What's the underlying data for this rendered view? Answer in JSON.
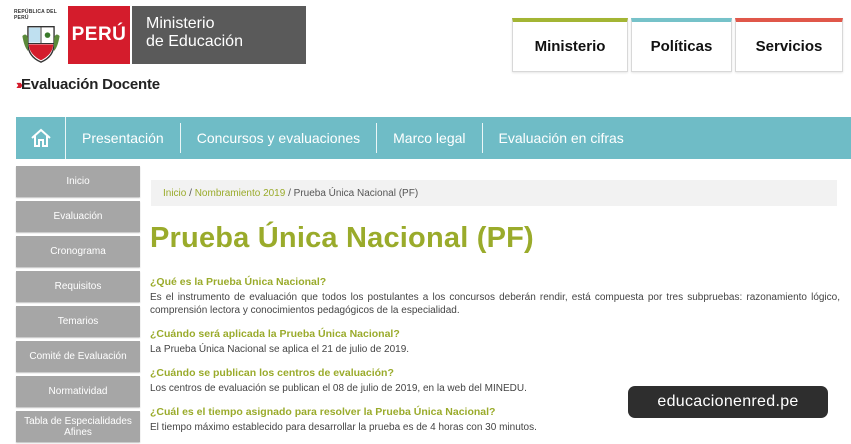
{
  "header": {
    "shield_text": "REPÚBLICA DEL PERÚ",
    "country": "PERÚ",
    "ministry_line1": "Ministerio",
    "ministry_line2": "de Educación",
    "section_chevrons": "›››",
    "section_title": "Evaluación Docente"
  },
  "top_tabs": [
    {
      "label": "Ministerio",
      "color": "#a3b534"
    },
    {
      "label": "Políticas",
      "color": "#76c2c9"
    },
    {
      "label": "Servicios",
      "color": "#e0574a"
    }
  ],
  "nav": {
    "home_icon": "home-icon",
    "items": [
      "Presentación",
      "Concursos y evaluaciones",
      "Marco legal",
      "Evaluación en cifras"
    ]
  },
  "sidebar": {
    "items": [
      "Inicio",
      "Evaluación",
      "Cronograma",
      "Requisitos",
      "Temarios",
      "Comité de Evaluación",
      "Normatividad",
      "Tabla de Especialidades Afines"
    ]
  },
  "breadcrumb": {
    "home": "Inicio",
    "sep1": " / ",
    "parent": "Nombramiento 2019",
    "sep2": " / ",
    "current": "Prueba Única Nacional (PF)"
  },
  "page_title": "Prueba Única Nacional (PF)",
  "faq": [
    {
      "question": "¿Qué es la Prueba Única Nacional?",
      "answer": "Es el instrumento de evaluación que todos los postulantes a los concursos deberán rendir, está compuesta por tres subpruebas: razonamiento lógico, comprensión lectora y conocimientos pedagógicos de la especialidad."
    },
    {
      "question": "¿Cuándo será aplicada la Prueba Única Nacional?",
      "answer": "La Prueba Única Nacional se aplica el 21 de julio de 2019."
    },
    {
      "question": "¿Cuándo se publican los centros de evaluación?",
      "answer": "Los centros de evaluación se publican el 08 de julio de 2019, en la web del MINEDU."
    },
    {
      "question": "¿Cuál es el tiempo asignado para resolver la Prueba Única Nacional?",
      "answer": "El tiempo máximo establecido para desarrollar la prueba es de 4 horas con 30 minutos."
    }
  ],
  "watermark": "educacionenred.pe",
  "colors": {
    "accent_green": "#9aab2b",
    "nav_teal": "#6fbcc6",
    "brand_red": "#d41c2c",
    "sidebar_gray": "#a6a6a6"
  }
}
